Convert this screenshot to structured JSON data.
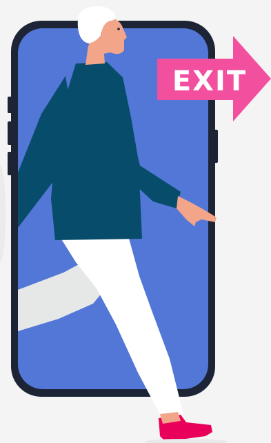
{
  "sign": {
    "label": "EXIT"
  },
  "colors": {
    "background": "#f4f4f4",
    "phone_frame": "#1c2436",
    "phone_screen": "#5277d6",
    "exit_sign": "#f24f9f",
    "sweater": "#074d6b",
    "pants": "#ffffff",
    "pants_shadow": "#e6e7e7",
    "skin": "#f3a58a",
    "hair": "#ffffff",
    "shoe": "#e8005a"
  },
  "icons": [
    "exit-arrow-icon",
    "phone-icon",
    "walking-person-icon"
  ]
}
